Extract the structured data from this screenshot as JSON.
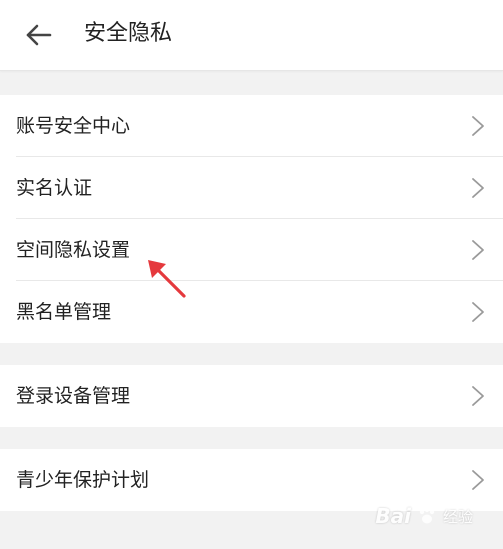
{
  "header": {
    "title": "安全隐私",
    "back_icon": "arrow-left-icon"
  },
  "groups": [
    {
      "items": [
        {
          "label": "账号安全中心",
          "icon": "chevron-right-icon"
        },
        {
          "label": "实名认证",
          "icon": "chevron-right-icon"
        },
        {
          "label": "空间隐私设置",
          "icon": "chevron-right-icon"
        },
        {
          "label": "黑名单管理",
          "icon": "chevron-right-icon"
        }
      ]
    },
    {
      "items": [
        {
          "label": "登录设备管理",
          "icon": "chevron-right-icon"
        }
      ]
    },
    {
      "items": [
        {
          "label": "青少年保护计划",
          "icon": "chevron-right-icon"
        }
      ]
    }
  ],
  "annotation": {
    "icon": "red-arrow-pointer-icon",
    "color": "#e5393d"
  },
  "watermark": {
    "brand": "Bai",
    "suffix": "经验"
  },
  "colors": {
    "background": "#f2f2f2",
    "surface": "#ffffff",
    "text": "#222222",
    "chevron": "#9a9a9a",
    "divider": "#e8e8e8"
  }
}
